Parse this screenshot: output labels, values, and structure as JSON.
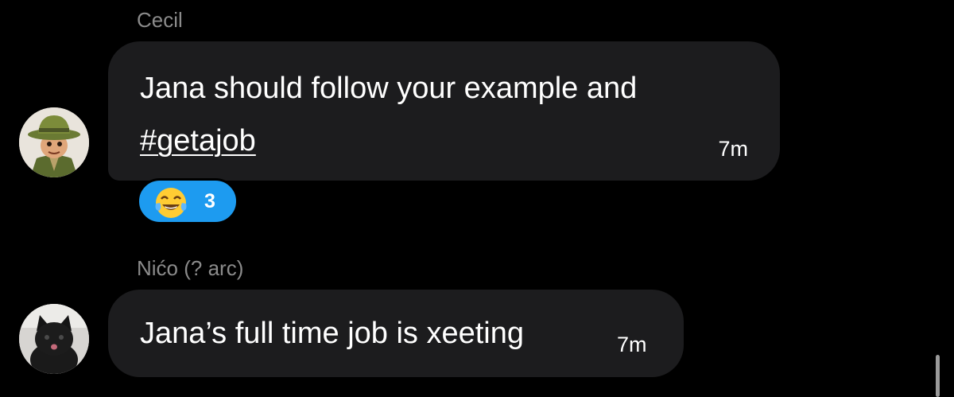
{
  "messages": [
    {
      "sender": "Cecil",
      "avatar_icon": "cartoon-boy-hat-avatar",
      "text_line1": "Jana should follow your example and",
      "hashtag": "#getajob",
      "time": "7m",
      "reaction": {
        "emoji": "😂",
        "emoji_icon": "face-with-tears-of-joy-icon",
        "count": "3"
      }
    },
    {
      "sender": "Nićo (? arc)",
      "avatar_icon": "black-kitten-avatar",
      "text": "Jana’s full time job is xeeting",
      "time": "7m"
    }
  ],
  "colors": {
    "background": "#000000",
    "bubble": "#1c1c1e",
    "sender_name": "#8b8b8b",
    "reaction_pill": "#1d9bf0",
    "text": "#ffffff"
  }
}
